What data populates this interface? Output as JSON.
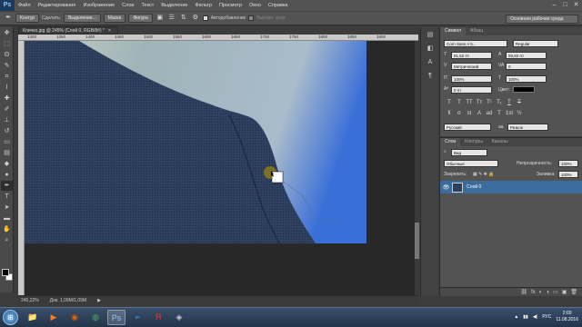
{
  "app": {
    "logo": "Ps"
  },
  "menu": [
    "Файл",
    "Редактирование",
    "Изображение",
    "Слои",
    "Текст",
    "Выделение",
    "Фильтр",
    "Просмотр",
    "Окно",
    "Справка"
  ],
  "window_controls": [
    "–",
    "□",
    "✕"
  ],
  "options": {
    "tool_mode": "Контур",
    "make_label": "Сделать:",
    "selection_btn": "Выделение...",
    "mask_btn": "Маска",
    "shape_btn": "Фигура",
    "auto_add_label": "Автодобавление",
    "align_edges_label": "Выровн. края",
    "workspace": "Основная рабочая среда"
  },
  "tools": [
    {
      "icon": "move-icon",
      "glyph": "✥"
    },
    {
      "icon": "marquee-icon",
      "glyph": "⬚"
    },
    {
      "icon": "lasso-icon",
      "glyph": "ʘ"
    },
    {
      "icon": "quick-select-icon",
      "glyph": "✎"
    },
    {
      "icon": "crop-icon",
      "glyph": "⌗"
    },
    {
      "icon": "eyedropper-icon",
      "glyph": "⌇"
    },
    {
      "icon": "healing-icon",
      "glyph": "✚"
    },
    {
      "icon": "brush-icon",
      "glyph": "✐"
    },
    {
      "icon": "stamp-icon",
      "glyph": "⊥"
    },
    {
      "icon": "history-brush-icon",
      "glyph": "↺"
    },
    {
      "icon": "eraser-icon",
      "glyph": "▭"
    },
    {
      "icon": "gradient-icon",
      "glyph": "▤"
    },
    {
      "icon": "blur-icon",
      "glyph": "◆"
    },
    {
      "icon": "dodge-icon",
      "glyph": "●"
    },
    {
      "icon": "pen-icon",
      "glyph": "✒"
    },
    {
      "icon": "type-icon",
      "glyph": "T"
    },
    {
      "icon": "path-select-icon",
      "glyph": "➤"
    },
    {
      "icon": "shape-icon",
      "glyph": "▬"
    },
    {
      "icon": "hand-icon",
      "glyph": "✋"
    },
    {
      "icon": "zoom-icon",
      "glyph": "⌕"
    }
  ],
  "document": {
    "tab_title": "Кличко.jpg @ 245% (Слой 0, RGB/8#) *",
    "ruler_ticks": [
      "1300",
      "1350",
      "1400",
      "1450",
      "1500",
      "1550",
      "1600",
      "1650",
      "1700",
      "1750",
      "1800",
      "1850",
      "1900"
    ],
    "zoom": "245,22%",
    "doc_size": "Док: 1,09М/1,09М"
  },
  "character_panel": {
    "tabs": [
      "Символ",
      "Абзац"
    ],
    "font_family": "Corn Sans A 5...",
    "font_style": "Regular",
    "font_size": "91,52 пт",
    "leading": "59,83 пт",
    "kerning": "Метрический",
    "tracking": "0",
    "scale_v": "100%",
    "scale_h": "100%",
    "baseline": "0 пт",
    "color_label": "Цвет:",
    "color_value": "#000000",
    "style_buttons": [
      "T",
      "T",
      "TT",
      "Tт",
      "T¹",
      "T₁",
      "T",
      "T"
    ],
    "extra_buttons": [
      "fi",
      "σ",
      "st",
      "A",
      "ad",
      "T",
      "1st",
      "½"
    ],
    "language": "Русский",
    "antialias_label": "aa",
    "antialias": "Резкое"
  },
  "layers_panel": {
    "tabs": [
      "Слои",
      "Контуры",
      "Каналы"
    ],
    "filter_label": "Вид",
    "blend_mode": "Обычные",
    "opacity_label": "Непрозрачность:",
    "opacity": "100%",
    "lock_label": "Закрепить:",
    "fill_label": "Заливка:",
    "fill": "100%",
    "layer_name": "Слой 0",
    "footer_icons": [
      "⛓",
      "fx",
      "◐",
      "◑",
      "▭",
      "▣",
      "🗑"
    ]
  },
  "taskbar": {
    "start_glyph": "⊞",
    "apps": [
      {
        "icon": "explorer-icon",
        "glyph": "📁",
        "color": "#e8b94a"
      },
      {
        "icon": "media-player-icon",
        "glyph": "▶",
        "color": "#ff7a1a"
      },
      {
        "icon": "firefox-icon",
        "glyph": "◉",
        "color": "#e66000"
      },
      {
        "icon": "chrome-icon",
        "glyph": "◍",
        "color": "#4caf50"
      },
      {
        "icon": "photoshop-icon",
        "glyph": "Ps",
        "color": "#8fc8ff"
      },
      {
        "icon": "telegram-icon",
        "glyph": "➢",
        "color": "#2ca5e0"
      },
      {
        "icon": "yandex-icon",
        "glyph": "Я",
        "color": "#ff3333"
      },
      {
        "icon": "app-icon",
        "glyph": "◈",
        "color": "#c8c8c8"
      }
    ],
    "language": "РУС",
    "time": "2:00",
    "date": "11.08.2016"
  },
  "colors": {
    "accent_selection": "#3c6c9c",
    "panel_bg": "#535353",
    "canvas_bg": "#282828"
  }
}
